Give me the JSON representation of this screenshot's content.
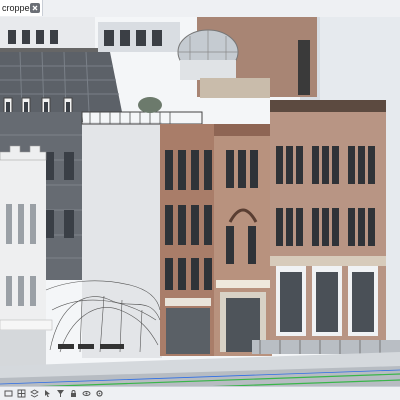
{
  "tab": {
    "label": "cropped",
    "close_icon": "close-icon"
  },
  "statusbar": {
    "icons": [
      "view-icon",
      "grid-icon",
      "layer-icon",
      "select-icon",
      "filter-icon",
      "lock-icon",
      "eye-icon",
      "settings-icon"
    ]
  },
  "colors": {
    "brick": "#a97d69",
    "brick_dark": "#8e6554",
    "stone": "#d7cbbb",
    "slate_roof": "#5a5f66",
    "glass": "#3a3f46",
    "accent_green": "#39b54a",
    "accent_blue": "#2d6ee6",
    "sky_wall": "#e9edf1"
  }
}
